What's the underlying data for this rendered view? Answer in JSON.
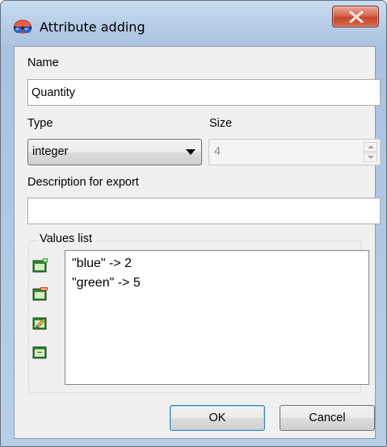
{
  "window": {
    "title": "Attribute adding",
    "icons": {
      "app": "stereo-glasses-icon",
      "close": "close-x-icon"
    }
  },
  "form": {
    "name_label": "Name",
    "name_value": "Quantity",
    "type_label": "Type",
    "type_value": "integer",
    "size_label": "Size",
    "size_value": "4",
    "size_disabled": true,
    "description_label": "Description for export",
    "description_value": ""
  },
  "values_list": {
    "title": "Values list",
    "tools": [
      "add-value-icon",
      "remove-value-icon",
      "edit-value-icon",
      "clear-values-icon"
    ],
    "items": [
      "\"blue\" -> 2",
      "\"green\" -> 5"
    ]
  },
  "buttons": {
    "ok": "OK",
    "cancel": "Cancel"
  },
  "colors": {
    "title_gradient_top": "#c9dcf0",
    "client_bg": "#f0f0f0",
    "close_red": "#c6462c",
    "default_btn_border": "#3c7fb1"
  }
}
